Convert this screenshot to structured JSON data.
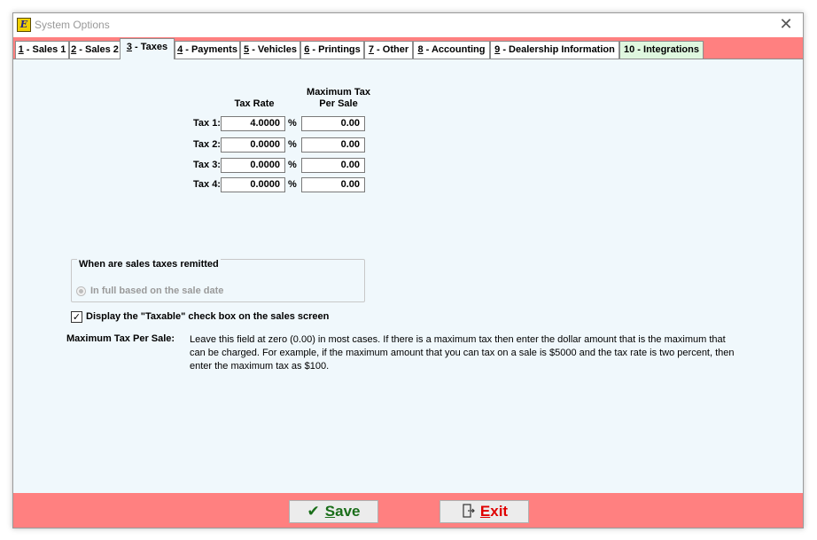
{
  "window": {
    "title": "System Options",
    "icon_text": "E"
  },
  "tabs": [
    {
      "key": "1",
      "label": " - Sales 1"
    },
    {
      "key": "2",
      "label": " - Sales 2"
    },
    {
      "key": "3",
      "label": " - Taxes"
    },
    {
      "key": "4",
      "label": " - Payments"
    },
    {
      "key": "5",
      "label": " - Vehicles"
    },
    {
      "key": "6",
      "label": " - Printings"
    },
    {
      "key": "7",
      "label": " - Other"
    },
    {
      "key": "8",
      "label": " - Accounting"
    },
    {
      "key": "9",
      "label": " - Dealership Information"
    },
    {
      "key": "10",
      "label": " - Integrations"
    }
  ],
  "active_tab": "3 - Taxes",
  "taxes": {
    "header_rate": "Tax Rate",
    "header_max_1": "Maximum Tax",
    "header_max_2": "Per Sale",
    "percent_symbol": "%",
    "rows": [
      {
        "label": "Tax 1:",
        "rate": "4.0000",
        "max": "0.00"
      },
      {
        "label": "Tax 2:",
        "rate": "0.0000",
        "max": "0.00"
      },
      {
        "label": "Tax 3:",
        "rate": "0.0000",
        "max": "0.00"
      },
      {
        "label": "Tax 4:",
        "rate": "0.0000",
        "max": "0.00"
      }
    ]
  },
  "remit": {
    "group_title": "When are sales taxes remitted",
    "option_label": "In full based on the sale date"
  },
  "taxable_checkbox": {
    "label": "Display the \"Taxable\" check box on the sales screen",
    "checked": true,
    "mark": "✓"
  },
  "help": {
    "title": "Maximum Tax Per Sale:",
    "text": "Leave this field at zero (0.00) in most cases. If there is a maximum tax then enter the dollar amount that is the maximum that can be charged.  For example, if the maximum amount that you can tax on a sale is $5000 and the tax rate is two percent, then enter the maximum tax as $100."
  },
  "footer": {
    "save_key": "S",
    "save_rest": "ave",
    "exit_key": "E",
    "exit_rest": "xit"
  },
  "colors": {
    "accent": "#ff8080",
    "panel": "#f0f8fc",
    "save": "#1a6e1a",
    "exit": "#e00000"
  }
}
